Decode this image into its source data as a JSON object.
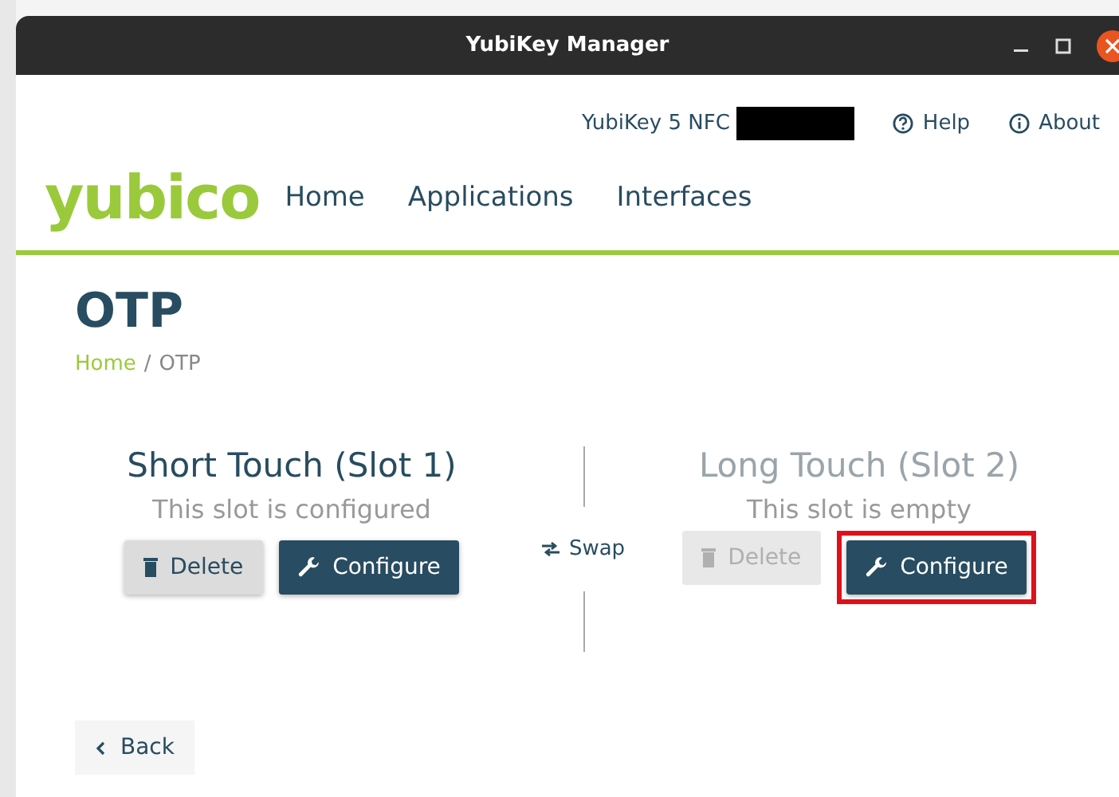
{
  "window": {
    "title": "YubiKey Manager"
  },
  "header": {
    "device": "YubiKey 5 NFC",
    "device_redacted": true,
    "links": [
      "Help",
      "About"
    ]
  },
  "logo": "yubico",
  "nav": [
    {
      "label": "Home"
    },
    {
      "label": "Applications"
    },
    {
      "label": "Interfaces"
    }
  ],
  "page": {
    "title": "OTP",
    "breadcrumb_separator": "/",
    "breadcrumb": [
      {
        "label": "Home",
        "link": true
      },
      {
        "label": "OTP",
        "link": false
      }
    ]
  },
  "slots": [
    {
      "title": "Short Touch (Slot 1)",
      "status": "This slot is configured",
      "configured": true,
      "delete": "Delete",
      "configure": "Configure",
      "highlighted": false
    },
    {
      "title": "Long Touch (Slot 2)",
      "status": "This slot is empty",
      "configured": false,
      "delete": "Delete",
      "configure": "Configure",
      "highlighted": true
    }
  ],
  "swap": "Swap",
  "back": "Back"
}
